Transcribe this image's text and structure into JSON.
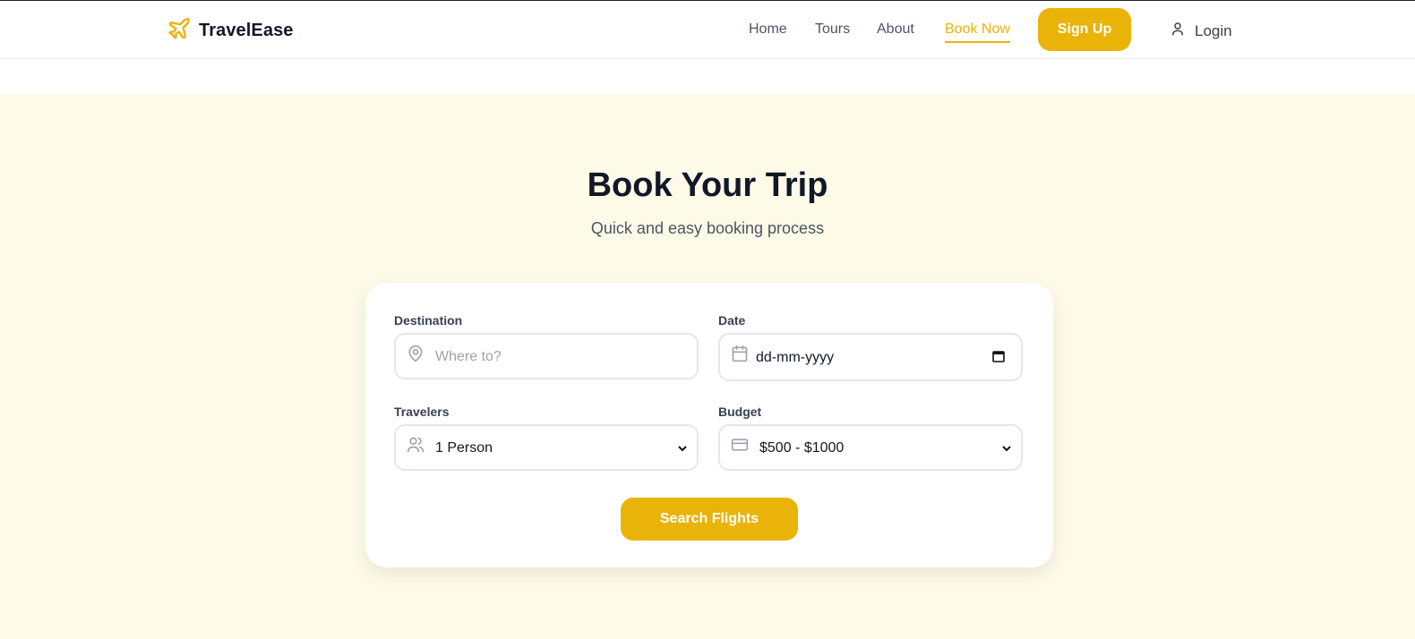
{
  "brand": {
    "name": "TravelEase",
    "logo_icon": "plane-icon",
    "accent": "#eab308"
  },
  "nav": {
    "items": [
      {
        "label": "Home",
        "active": false
      },
      {
        "label": "Tours",
        "active": false
      },
      {
        "label": "About",
        "active": false
      },
      {
        "label": "Book Now",
        "active": true
      }
    ],
    "signup_label": "Sign Up",
    "login_label": "Login"
  },
  "hero": {
    "title": "Book Your Trip",
    "subtitle": "Quick and easy booking process",
    "background": "#fefae8"
  },
  "form": {
    "destination": {
      "label": "Destination",
      "placeholder": "Where to?",
      "icon": "map-pin-icon"
    },
    "date": {
      "label": "Date",
      "placeholder": "dd-mm-yyyy",
      "icon": "calendar-icon"
    },
    "travelers": {
      "label": "Travelers",
      "value": "1 Person",
      "icon": "users-icon"
    },
    "budget": {
      "label": "Budget",
      "value": "$500 - $1000",
      "icon": "credit-card-icon"
    },
    "submit_label": "Search Flights"
  }
}
